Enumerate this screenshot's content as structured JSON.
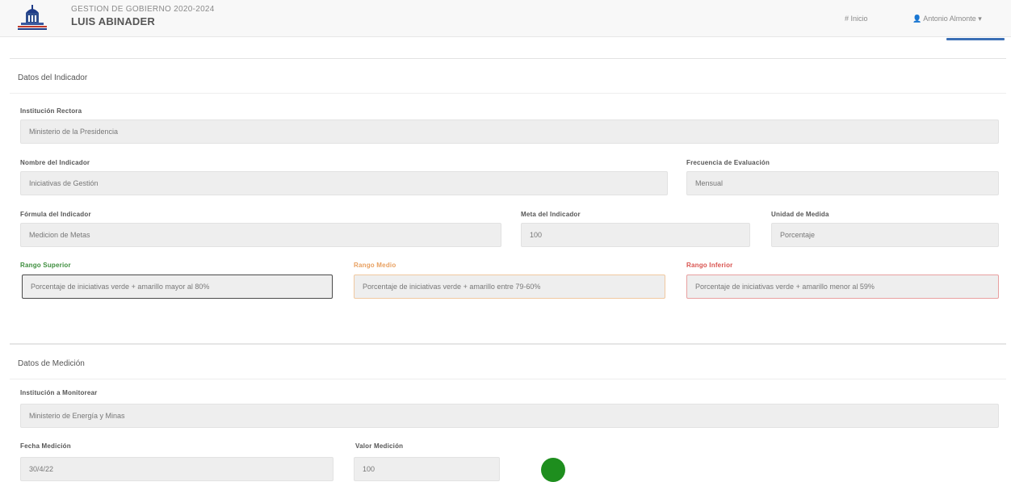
{
  "header": {
    "subtitle": "GESTION DE GOBIERNO 2020-2024",
    "title": "LUIS ABINADER",
    "home_label": "# Inicio",
    "user_label": "Antonio Almonte ▾"
  },
  "indicator_section": {
    "heading": "Datos del Indicador",
    "institucion_rectora": {
      "label": "Institución Rectora",
      "value": "Ministerio de la Presidencia"
    },
    "nombre_indicador": {
      "label": "Nombre del Indicador",
      "value": "Iniciativas de Gestión"
    },
    "frecuencia": {
      "label": "Frecuencia de Evaluación",
      "value": "Mensual"
    },
    "formula": {
      "label": "Fórmula del Indicador",
      "value": "Medicion de Metas"
    },
    "meta": {
      "label": "Meta del Indicador",
      "value": "100"
    },
    "unidad": {
      "label": "Unidad de Medida",
      "value": "Porcentaje"
    },
    "rango_superior": {
      "label": "Rango Superior",
      "value": "Porcentaje de iniciativas verde + amarillo mayor al 80%"
    },
    "rango_medio": {
      "label": "Rango Medio",
      "value": "Porcentaje de iniciativas verde + amarillo entre 79-60%"
    },
    "rango_inferior": {
      "label": "Rango Inferior",
      "value": "Porcentaje de iniciativas verde + amarillo menor al 59%"
    }
  },
  "measurement_section": {
    "heading": "Datos de Medición",
    "institucion_monitorear": {
      "label": "Institución a Monitorear",
      "value": "Ministerio de Energía y Minas"
    },
    "fecha": {
      "label": "Fecha Medición",
      "value": "30/4/22"
    },
    "valor": {
      "label": "Valor Medición",
      "value": "100"
    },
    "status_color": "#1e8e1e"
  },
  "colors": {
    "superior": "#3c8d3c",
    "medio": "#e8a060",
    "inferior": "#d9534f",
    "accent": "#3b6fb5"
  }
}
